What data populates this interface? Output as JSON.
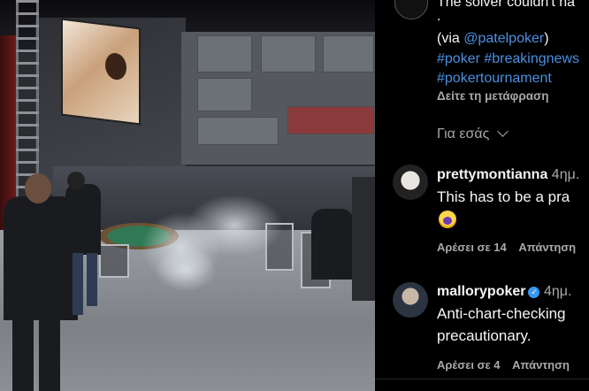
{
  "caption": {
    "truncated_line": "The solver couldn't ha",
    "dot": ".",
    "via_prefix": "(via ",
    "via_handle": "@patelpoker",
    "via_suffix": ")",
    "hashtags_line1": "#poker #breakingnews",
    "hashtags_line2": "#pokertournament",
    "translate": "Δείτε τη μετάφραση"
  },
  "for_you": {
    "label": "Για εσάς",
    "icon": "chevron-down-icon"
  },
  "comments": [
    {
      "username": "prettymontianna",
      "time": "4ημ.",
      "text": "This has to be a pra",
      "emoji": "scream-emoji",
      "likes": "Αρέσει σε 14",
      "reply": "Απάντηση",
      "verified": false
    },
    {
      "username": "mallorypoker",
      "time": "4ημ.",
      "text_line1": "Anti-chart-checking",
      "text_line2": "precautionary.",
      "likes": "Αρέσει σε 4",
      "reply": "Απάντηση",
      "verified": true
    }
  ],
  "colors": {
    "link": "#4a90e2",
    "muted": "#a8a8a8",
    "verified": "#3897f0",
    "background": "#000000"
  }
}
